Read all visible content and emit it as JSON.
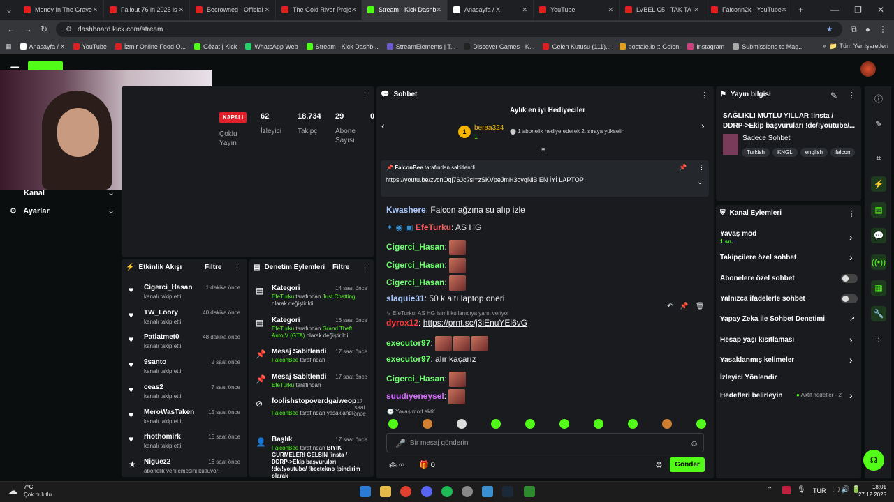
{
  "browser": {
    "tabs": [
      {
        "label": "Money In The Grave",
        "color": "#e02020"
      },
      {
        "label": "Fallout 76 in 2025 is",
        "color": "#e02020"
      },
      {
        "label": "Becrowned - Official",
        "color": "#e02020"
      },
      {
        "label": "The Gold River Proje",
        "color": "#e02020"
      },
      {
        "label": "Stream - Kick Dashb",
        "color": "#53fc18"
      },
      {
        "label": "Anasayfa / X",
        "color": "#ffffff"
      },
      {
        "label": "YouTube",
        "color": "#e02020"
      },
      {
        "label": "LVBEL C5 - TAK TA",
        "color": "#e02020"
      },
      {
        "label": "Falconn2k - YouTube",
        "color": "#e02020"
      }
    ],
    "url": "dashboard.kick.com/stream",
    "bookmarks": [
      "Anasayfa / X",
      "YouTube",
      "İzmir Online Food O...",
      "Gözat | Kick",
      "WhatsApp Web",
      "Stream - Kick Dashb...",
      "StreamElements | T...",
      "Discover Games - K...",
      "Gelen Kutusu (111)...",
      "postale.io :: Gelen",
      "Instagram",
      "Submissions to Mag..."
    ],
    "all_bookmarks": "Tüm Yer İşaretleri"
  },
  "sidebar": {
    "kanal": "Kanal",
    "ayarlar": "Ayarlar"
  },
  "stats": {
    "status": "KAPALI",
    "status_label": "Çoklu Yayın",
    "viewers": "62",
    "viewers_label": "İzleyici",
    "followers": "18.734",
    "followers_label": "Takipçi",
    "subs": "29",
    "subs_label": "Abone Sayısı",
    "other": "0"
  },
  "activity": {
    "title": "Etkinlik Akışı",
    "filter": "Filtre",
    "items": [
      {
        "name": "Cigerci_Hasan",
        "sub": "kanalı takip etti",
        "time": "1 dakika önce"
      },
      {
        "name": "TW_Loory",
        "sub": "kanalı takip etti",
        "time": "40 dakika önce"
      },
      {
        "name": "Patlatmet0",
        "sub": "kanalı takip etti",
        "time": "48 dakika önce"
      },
      {
        "name": "9santo",
        "sub": "kanalı takip etti",
        "time": "2 saat önce"
      },
      {
        "name": "ceas2",
        "sub": "kanalı takip etti",
        "time": "7 saat önce"
      },
      {
        "name": "MeroWasTaken",
        "sub": "kanalı takip etti",
        "time": "15 saat önce"
      },
      {
        "name": "rhothomirk",
        "sub": "kanalı takip etti",
        "time": "15 saat önce"
      },
      {
        "name": "Niguez2",
        "sub": "abonelik venilemesini kutluvor!",
        "time": "16 saat önce"
      }
    ]
  },
  "moderation": {
    "title": "Denetim Eylemleri",
    "filter": "Filtre",
    "items": [
      {
        "title": "Kategori",
        "time": "14 saat önce",
        "actor": "EfeTurku",
        "mid": "tarafından",
        "highlight": "Just Chatting",
        "rest": "olarak değiştirildi"
      },
      {
        "title": "Kategori",
        "time": "16 saat önce",
        "actor": "EfeTurku",
        "mid": "tarafından",
        "highlight": "Grand Theft Auto V (GTA)",
        "rest": "olarak değiştirildi"
      },
      {
        "title": "Mesaj Sabitlendi",
        "time": "17 saat önce",
        "actor": "FalconBee",
        "mid": "tarafından",
        "highlight": "",
        "rest": ""
      },
      {
        "title": "Mesaj Sabitlendi",
        "time": "17 saat önce",
        "actor": "EfeTurku",
        "mid": "tarafından",
        "highlight": "",
        "rest": ""
      },
      {
        "title": "foolishstopoverdgaiweop",
        "time": "17 saat önce",
        "actor": "FalconBee",
        "mid": "tarafından yasaklandı",
        "highlight": "",
        "rest": ""
      },
      {
        "title": "Başlık",
        "time": "17 saat önce",
        "actor": "FalconBee",
        "mid": "tarafından",
        "highlight": "",
        "rest": "BIYIK GURMELERİ GELSİN !insta / DDRP->Ekip başvuruları !dc/!youtube/ !beetekno !pindirim olarak"
      }
    ]
  },
  "chat": {
    "title": "Sohbet",
    "gifters_title": "Aylık en iyi Hediyeciler",
    "top_gifter": "beraa324",
    "gifter_rank": "1",
    "gifter_count": "1",
    "gifter_note": "1 abonelik hediye ederek 2. sıraya yükselin",
    "pinned_by": "FalconBee",
    "pinned_suffix": "tarafından sabitlendi",
    "pinned_link": "https://youtu.be/zvcnOqj76Jc?si=zSKVpeJmH3ovqNiB",
    "pinned_text": "EN İYİ LAPTOP",
    "messages": [
      {
        "user": "Kwashere",
        "text": "Falcon ağzına su alıp izle",
        "color": "#a8c7ff"
      },
      {
        "user": "EfeTurku",
        "text": "AS HG",
        "color": "#ff5c5c"
      },
      {
        "user": "Cigerci_Hasan",
        "text": "",
        "color": "#6cff6c"
      },
      {
        "user": "Cigerci_Hasan",
        "text": "",
        "color": "#6cff6c"
      },
      {
        "user": "Cigerci_Hasan",
        "text": "",
        "color": "#6cff6c"
      },
      {
        "user": "slaquie31",
        "text": "50 k altı laptop oneri",
        "color": "#a8c7ff"
      },
      {
        "user": "dyrox12",
        "text": "https://prnt.sc/j3iEnuYEi6vG",
        "color": "#ff3b3b"
      },
      {
        "user": "executor97",
        "text": "",
        "color": "#6cff6c"
      },
      {
        "user": "executor97",
        "text": "alır kaçarız",
        "color": "#6cff6c"
      },
      {
        "user": "Cigerci_Hasan",
        "text": "",
        "color": "#6cff6c"
      },
      {
        "user": "suudiyeneysel",
        "text": "",
        "color": "#d56cff"
      }
    ],
    "reply_note": "EfeTurku: AS HG isimli kullanıcıya yanıt veriyor",
    "slow_mode_note": "Yavaş mod aktif",
    "input_placeholder": "Bir mesaj gönderin",
    "infinity_label": "∞",
    "gift_count": "0",
    "send": "Gönder"
  },
  "stream_info": {
    "title": "Yayın bilgisi",
    "stream_title": "SAĞLIKLI MUTLU YILLAR !insta / DDRP->Ekip başvuruları !dc/!youtube/...",
    "category": "Sadece Sohbet",
    "tags": [
      "Turkish",
      "KNGL",
      "english",
      "falcon"
    ]
  },
  "channel_actions": {
    "title": "Kanal Eylemleri",
    "slow_mode": "Yavaş mod",
    "slow_mode_value": "1 sn.",
    "followers_only": "Takipçilere özel sohbet",
    "subs_only": "Abonelere özel sohbet",
    "emotes_only": "Yalnızca ifadelerle sohbet",
    "ai_mod": "Yapay Zeka ile Sohbet Denetimi",
    "age": "Hesap yaşı kısıtlaması",
    "banned_words": "Yasaklanmış kelimeler",
    "redirect": "İzleyici Yönlendir",
    "goals": "Hedefleri belirleyin",
    "goals_status": "Aktif hedefler - 2"
  },
  "taskbar": {
    "weather_temp": "7°C",
    "weather_desc": "Çok bulutlu",
    "lang": "TUR",
    "time": "18:01",
    "date": "27.12.2025"
  }
}
